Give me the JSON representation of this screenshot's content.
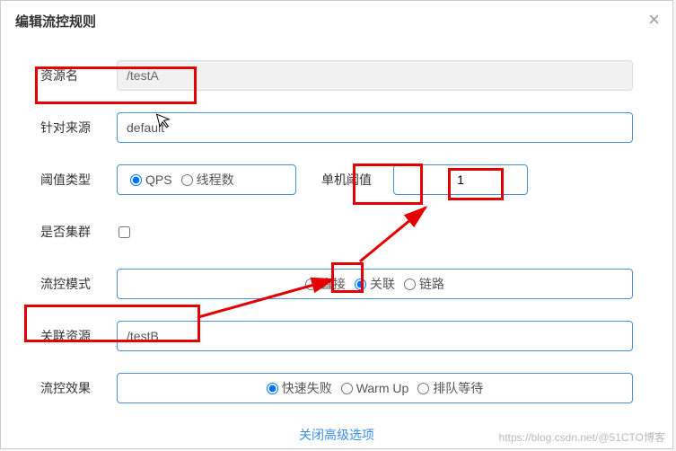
{
  "header": {
    "title": "编辑流控规则",
    "close": "×"
  },
  "form": {
    "resourceName": {
      "label": "资源名",
      "value": "/testA"
    },
    "origin": {
      "label": "针对来源",
      "value": "default"
    },
    "thresholdType": {
      "label": "阈值类型",
      "options": {
        "qps": "QPS",
        "thread": "线程数"
      }
    },
    "singleThreshold": {
      "label": "单机阈值",
      "value": "1"
    },
    "cluster": {
      "label": "是否集群"
    },
    "mode": {
      "label": "流控模式",
      "options": {
        "direct": "直接",
        "relation": "关联",
        "chain": "链路"
      }
    },
    "relatedResource": {
      "label": "关联资源",
      "value": "/testB"
    },
    "effect": {
      "label": "流控效果",
      "options": {
        "fastFail": "快速失败",
        "warmUp": "Warm Up",
        "queue": "排队等待"
      }
    }
  },
  "footer": {
    "closeAdvanced": "关闭高级选项"
  },
  "watermark": "https://blog.csdn.net/@51CTO博客"
}
